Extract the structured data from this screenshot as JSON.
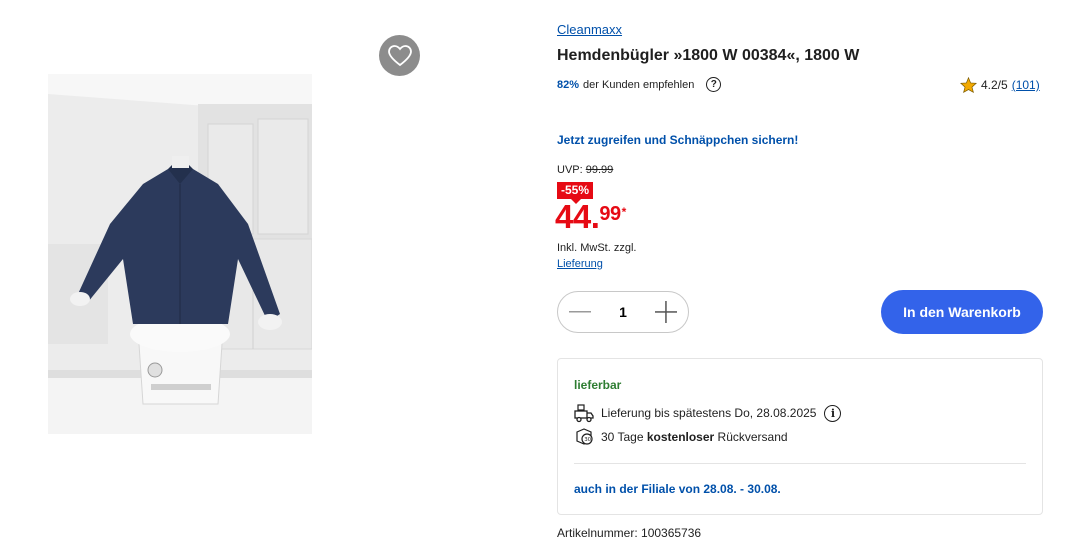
{
  "product": {
    "brand": "Cleanmaxx",
    "title": "Hemdenbügler »1800 W 00384«, 1800 W",
    "recommend_pct": "82%",
    "recommend_text": "der Kunden empfehlen",
    "rating_value": "4.2/5",
    "rating_count": "(101)",
    "promo_text": "Jetzt zugreifen und Schnäppchen sichern!",
    "uvp_label": "UVP:",
    "uvp_price": "99.99",
    "discount": "-55%",
    "price_main": "44.",
    "price_cents": "99",
    "price_mark": "*",
    "vat_text": "Inkl. MwSt. zzgl.",
    "delivery_link": "Lieferung",
    "quantity": "1",
    "cart_button": "In den Warenkorb",
    "availability": {
      "status": "lieferbar",
      "delivery_text": "Lieferung bis spätestens Do, 28.08.2025",
      "return_prefix": "30 Tage",
      "return_bold": "kostenloser",
      "return_suffix": "Rückversand",
      "store_text": "auch in der Filiale von 28.08. - 30.08."
    },
    "article_number": "Artikelnummer: 100365736"
  },
  "colors": {
    "accent_blue": "#0050aa",
    "cart_button": "#3363ea",
    "price_red": "#e60a14",
    "stock_green": "#2e7d32",
    "star": "#f2a900"
  },
  "icons": [
    "heart-icon",
    "help-icon",
    "star-icon",
    "minus-icon",
    "plus-icon",
    "delivery-truck-icon",
    "info-icon",
    "return-box-icon"
  ]
}
